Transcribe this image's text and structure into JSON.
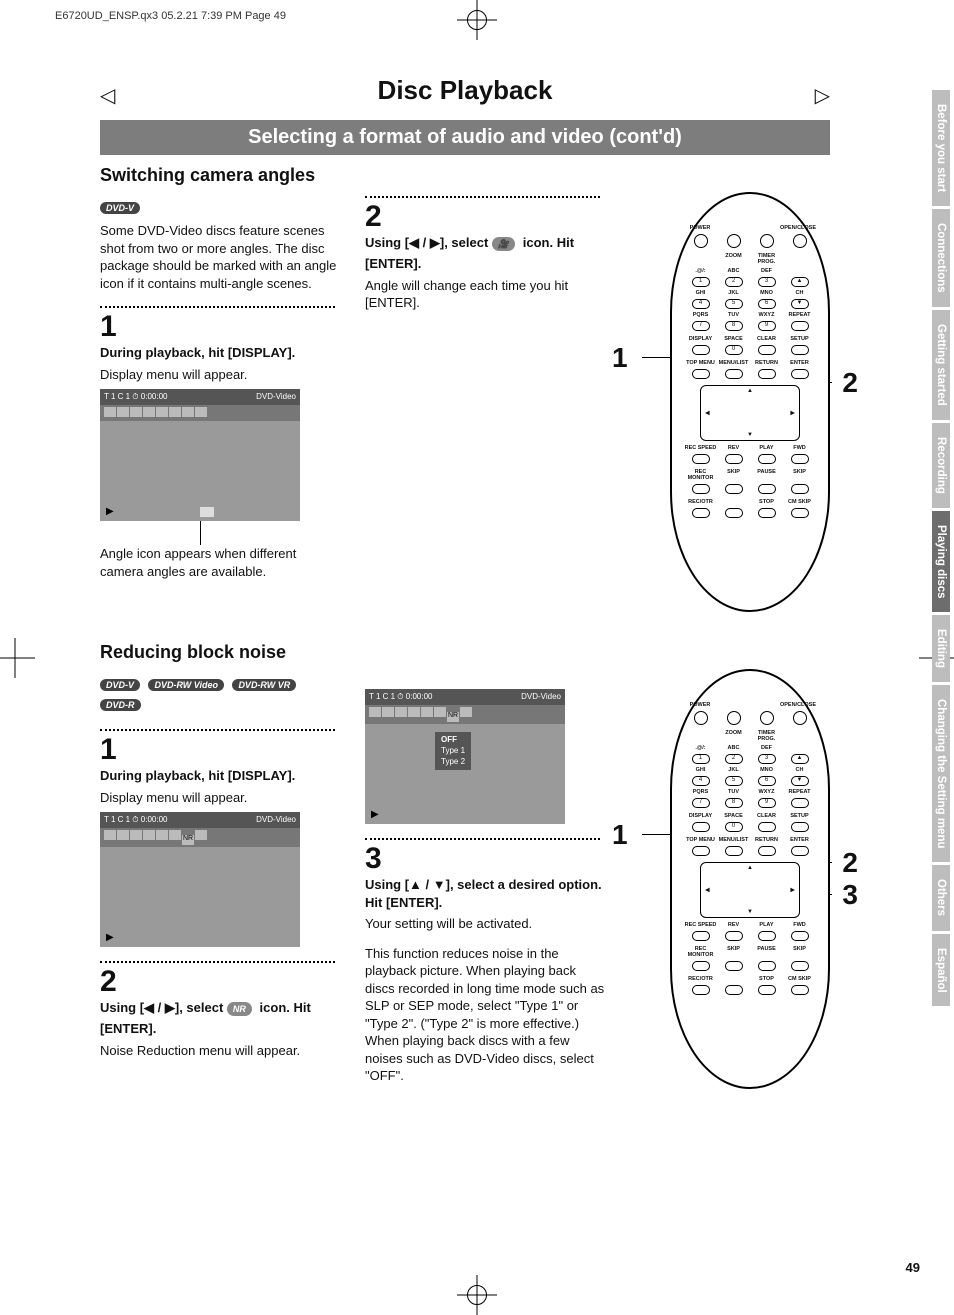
{
  "print_header": "E6720UD_ENSP.qx3  05.2.21 7:39 PM  Page 49",
  "page_number": "49",
  "title": "Disc Playback",
  "subtitle": "Selecting a format of audio and video (cont'd)",
  "section_a": {
    "heading": "Switching camera angles",
    "badge1": "DVD-V",
    "intro": "Some DVD-Video discs feature scenes shot from two or more angles. The disc package should be marked with an angle icon if it contains multi-angle scenes.",
    "step1_num": "1",
    "step1_bold": "During playback, hit [DISPLAY].",
    "step1_body": "Display menu will appear.",
    "osd_top_left": "T  1   C  1   ⏱ 0:00:00",
    "osd_top_right": "DVD-Video",
    "step1_caption": "Angle icon appears when different camera angles are available.",
    "step2_num": "2",
    "step2_bold_a": "Using [◀ / ▶], select ",
    "step2_bold_b": " icon. Hit [ENTER].",
    "step2_body": "Angle will change each time you hit [ENTER].",
    "remote_callout_left": "1",
    "remote_callout_right": "2"
  },
  "section_b": {
    "heading": "Reducing block noise",
    "badges": [
      "DVD-V",
      "DVD-RW Video",
      "DVD-RW VR",
      "DVD-R"
    ],
    "step1_num": "1",
    "step1_bold": "During playback, hit [DISPLAY].",
    "step1_body": "Display menu will appear.",
    "osd_top_left": "T  1   C  1   ⏱ 0:00:00",
    "osd_top_right": "DVD-Video",
    "step2_num": "2",
    "step2_bold_a": "Using [◀ / ▶], select ",
    "step2_nr": "NR",
    "step2_bold_b": " icon. Hit [ENTER].",
    "step2_body": "Noise Reduction menu will appear.",
    "osd_menu_off": "OFF",
    "osd_menu_t1": "Type 1",
    "osd_menu_t2": "Type 2",
    "step3_num": "3",
    "step3_bold": "Using [▲ / ▼], select a desired option. Hit [ENTER].",
    "step3_body1": "Your setting will be activated.",
    "step3_body2": "This function reduces noise in the playback picture. When playing back discs recorded in long time mode such as SLP or SEP mode, select \"Type 1\" or \"Type 2\". (\"Type 2\" is more effective.) When playing back discs with a few noises such as DVD-Video discs, select \"OFF\".",
    "remote_callout_left": "1",
    "remote_callout_right_1": "2",
    "remote_callout_right_2": "3"
  },
  "remote": {
    "r0": [
      "POWER",
      "",
      "",
      "OPEN/CLOSE"
    ],
    "r0b": [
      "",
      "ZOOM",
      "TIMER PROG.",
      ""
    ],
    "r1": [
      ".@/:",
      "ABC",
      "DEF",
      ""
    ],
    "n1": [
      "1",
      "2",
      "3",
      "▲"
    ],
    "r2": [
      "GHI",
      "JKL",
      "MNO",
      "CH"
    ],
    "n2": [
      "4",
      "5",
      "6",
      "▼"
    ],
    "r3": [
      "PQRS",
      "TUV",
      "WXYZ",
      "REPEAT"
    ],
    "n3": [
      "7",
      "8",
      "9",
      ""
    ],
    "r4": [
      "DISPLAY",
      "SPACE",
      "CLEAR",
      "SETUP"
    ],
    "n4": [
      "",
      "0",
      "",
      ""
    ],
    "r5": [
      "TOP MENU",
      "MENU/LIST",
      "RETURN",
      "ENTER"
    ],
    "dpad": {
      "up": "▲",
      "down": "▼",
      "left": "◀",
      "right": "▶"
    },
    "r6": [
      "REC SPEED",
      "REV",
      "PLAY",
      "FWD"
    ],
    "r7": [
      "REC MONITOR",
      "SKIP",
      "PAUSE",
      "SKIP"
    ],
    "r8": [
      "REC/OTR",
      "",
      "STOP",
      "CM SKIP"
    ]
  },
  "tabs": [
    "Before you start",
    "Connections",
    "Getting started",
    "Recording",
    "Playing discs",
    "Editing",
    "Changing the Setting menu",
    "Others",
    "Español"
  ],
  "active_tab_index": 4
}
